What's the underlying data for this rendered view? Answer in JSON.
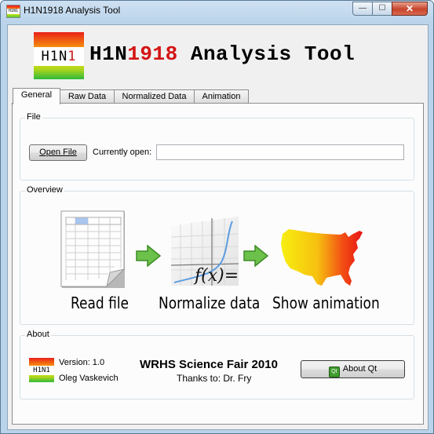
{
  "window": {
    "title": "H1N1918 Analysis Tool",
    "icon_text": "H1N1"
  },
  "window_buttons": {
    "minimize": "—",
    "maximize": "☐",
    "close": "✕"
  },
  "header": {
    "logo_prefix": "H1N",
    "logo_digit": "1",
    "title_prefix": "H1N",
    "title_highlight": "1918",
    "title_suffix": " Analysis Tool"
  },
  "tabs": [
    {
      "label": "General",
      "active": true
    },
    {
      "label": "Raw Data"
    },
    {
      "label": "Normalized Data"
    },
    {
      "label": "Animation"
    }
  ],
  "file_group": {
    "title": "File",
    "open_button": "Open File",
    "currently_open_label": "Currently open:",
    "currently_open_value": ""
  },
  "overview": {
    "title": "Overview",
    "steps": [
      {
        "icon": "spreadsheet-icon",
        "label": "Read file"
      },
      {
        "icon": "function-graph-icon",
        "label": "Normalize data"
      },
      {
        "icon": "us-map-icon",
        "label": "Show animation"
      }
    ],
    "formula": "f(x)="
  },
  "about": {
    "title": "About",
    "logo_text": "H1N1",
    "version": "Version: 1.0",
    "author": "Oleg Vaskevich",
    "fair": "WRHS Science Fair 2010",
    "thanks": "Thanks to: Dr. Fry",
    "about_qt_button": "About Qt",
    "qt_icon_text": "Qt"
  },
  "colors": {
    "title_red": "#d41414",
    "arrow_green": "#6cc14a",
    "map_gradient": [
      "#f3e600",
      "#ee1c1c"
    ]
  }
}
